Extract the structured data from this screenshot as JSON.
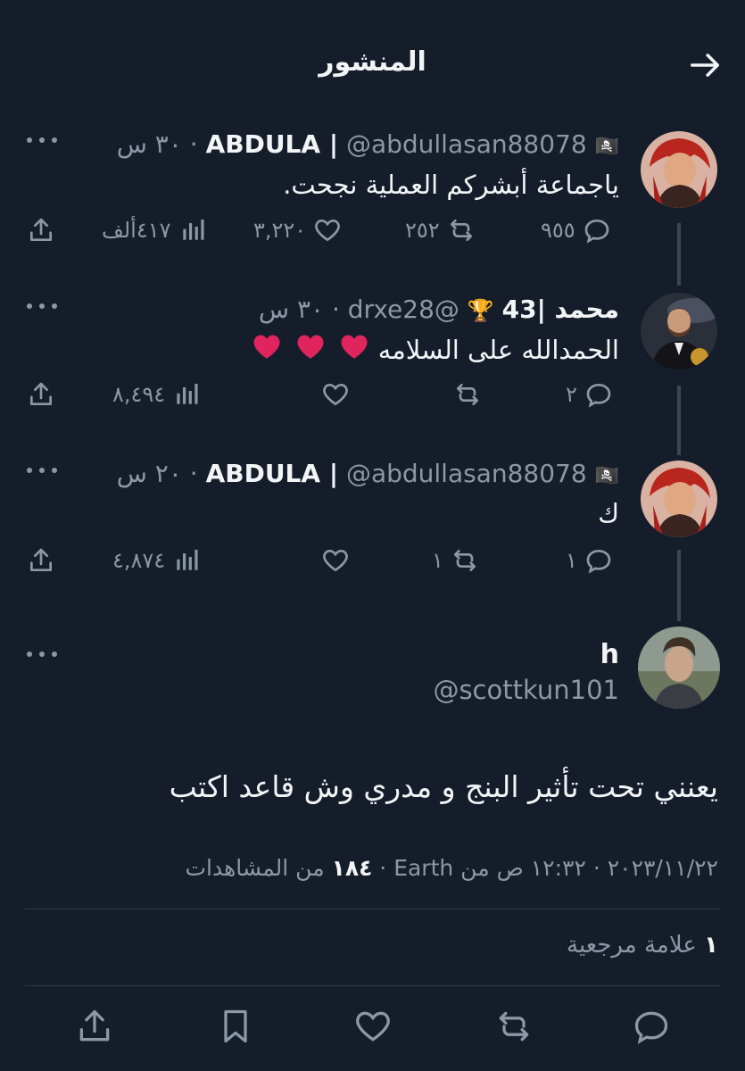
{
  "header": {
    "title": "المنشور"
  },
  "tweets": [
    {
      "name": "ABDULA |",
      "flag": "🏴‍☠️",
      "handle": "@abdullasan88078",
      "time": "٣٠ س",
      "text": "ياجماعة أبشركم العملية نجحت.",
      "replies": "٩٥٥",
      "retweets": "٢٥٢",
      "likes": "٣,٢٢٠",
      "views": "٤١٧ألف"
    },
    {
      "name": "محمد |43",
      "trophy": "🏆",
      "handle": "@drxe28",
      "time": "٣٠ س",
      "text": "الحمدالله على السلامه",
      "replies": "٢",
      "retweets": "",
      "likes": "",
      "views": "٨,٤٩٤"
    },
    {
      "name": "ABDULA |",
      "flag": "🏴‍☠️",
      "handle": "@abdullasan88078",
      "time": "٢٠ س",
      "text": "ك",
      "replies": "١",
      "retweets": "١",
      "likes": "",
      "views": "٤,٨٧٤"
    }
  ],
  "focal": {
    "name": "h",
    "handle": "@scottkun101",
    "text": "يعنني تحت تأثير البنج و مدري وش قاعد اكتب",
    "timestamp": "١٢:٣٢ ص",
    "date": "٢٠٢٣/١١/٢٢",
    "location": "من Earth",
    "views_count": "١٨٤",
    "views_label": "من المشاهدات",
    "bookmarks_count": "١",
    "bookmarks_label": "علامة مرجعية"
  },
  "colors": {
    "background": "#151d2a",
    "text": "#f2f4f6",
    "muted": "#8b98a5",
    "heart": "#e0245e"
  }
}
